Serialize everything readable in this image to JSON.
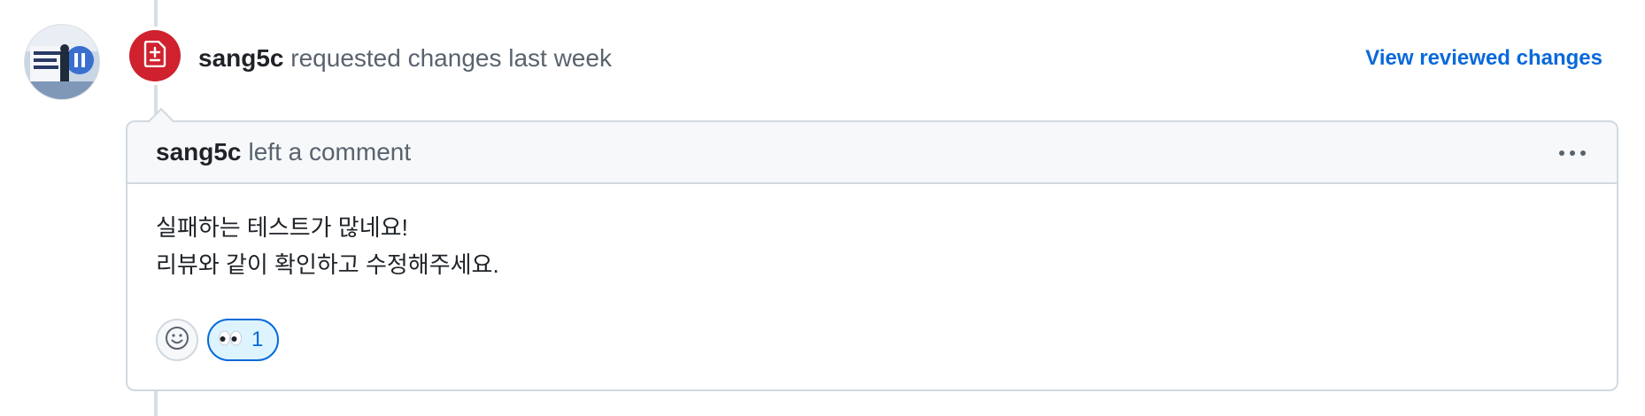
{
  "review": {
    "author": "sang5c",
    "action_text": " requested changes last week",
    "view_link": "View reviewed changes"
  },
  "comment": {
    "author": "sang5c",
    "action_text": "left a comment",
    "body_lines": [
      "실패하는 테스트가 많네요!",
      "리뷰와 같이 확인하고 수정해주세요."
    ]
  },
  "reactions": {
    "items": [
      {
        "icon": "eyes-emoji-icon",
        "count": "1"
      }
    ]
  },
  "icons": {
    "badge": "file-diff-icon",
    "add_reaction": "smiley-icon",
    "menu": "kebab-horizontal-icon"
  },
  "colors": {
    "badge_red": "#cf222e",
    "link_blue": "#0969da",
    "reaction_bg": "#ddf4ff"
  }
}
